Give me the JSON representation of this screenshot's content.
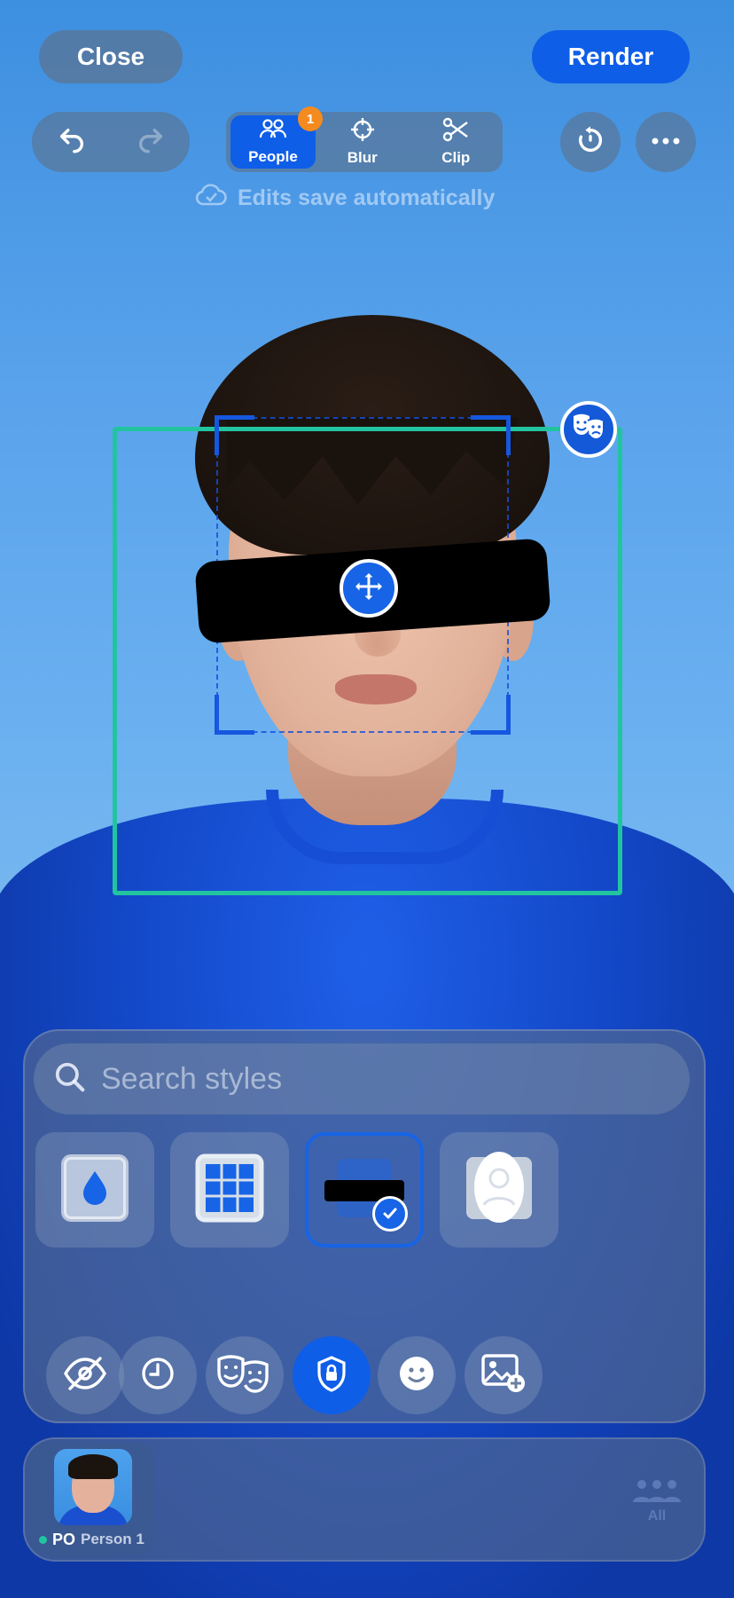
{
  "topbar": {
    "close_label": "Close",
    "render_label": "Render",
    "autosave_text": "Edits save automatically"
  },
  "tools": [
    {
      "label": "People",
      "icon": "people-icon",
      "badge": "1",
      "active": true
    },
    {
      "label": "Blur",
      "icon": "crosshair-icon",
      "active": false
    },
    {
      "label": "Clip",
      "icon": "scissors-icon",
      "active": false
    }
  ],
  "search": {
    "placeholder": "Search styles"
  },
  "styles": [
    {
      "name": "blur-style",
      "icon": "water-drop-icon",
      "selected": false
    },
    {
      "name": "pixelate-style",
      "icon": "pixel-grid-icon",
      "selected": false
    },
    {
      "name": "bar-style",
      "icon": "censor-bar-icon",
      "selected": true
    },
    {
      "name": "silhouette-style",
      "icon": "person-silhouette-icon",
      "selected": false
    }
  ],
  "options": [
    {
      "icon": "eye-slash-icon"
    },
    {
      "icon": "clock-icon"
    },
    {
      "icon": "theater-masks-icon"
    },
    {
      "icon": "shield-lock-icon",
      "active": true
    },
    {
      "icon": "smiley-icon"
    },
    {
      "icon": "image-add-icon"
    }
  ],
  "people": [
    {
      "initials": "PO",
      "name": "Person 1"
    }
  ],
  "all_label": "All",
  "colors": {
    "accent": "#0e5ee8",
    "person_box": "#22c4a0",
    "badge": "#f58a1f"
  }
}
